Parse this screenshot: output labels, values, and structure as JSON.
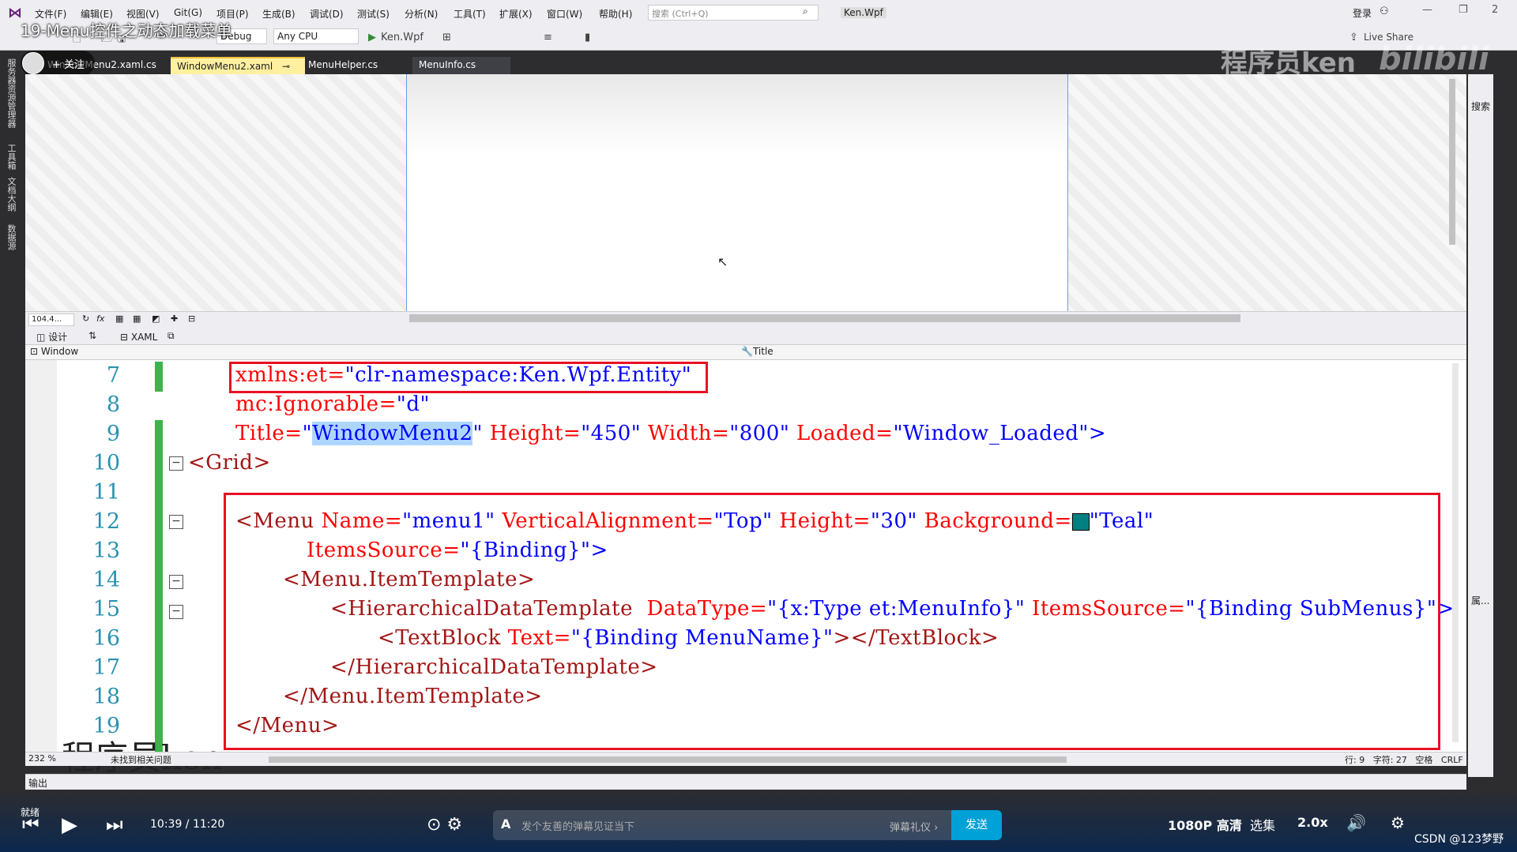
{
  "app": {
    "menu": [
      "文件(F)",
      "编辑(E)",
      "视图(V)",
      "Git(G)",
      "项目(P)",
      "生成(B)",
      "调试(D)",
      "测试(S)",
      "分析(N)",
      "工具(T)",
      "扩展(X)",
      "窗口(W)",
      "帮助(H)"
    ],
    "search_placeholder": "搜索 (Ctrl+Q)",
    "solution_name": "Ken.Wpf",
    "login_label": "登录",
    "live_share_label": "Live Share",
    "help_badge": "2"
  },
  "toolbar": {
    "config": "Debug",
    "platform": "Any CPU",
    "start_target": "Ken.Wpf"
  },
  "video": {
    "title": "19-Menu控件之动态加载菜单",
    "follow_label": "+ 关注",
    "watermark_top": "程序员ken",
    "bili_logo": "bilibili",
    "watermark_bottom": "程序员ken",
    "time": "10:39 / 11:20",
    "danmaku_placeholder": "发个友善的弹幕见证当下",
    "danmaku_gift": "弹幕礼仪 ›",
    "send_label": "发送",
    "quality": "1080P 高清",
    "episodes": "选集",
    "speed": "2.0x",
    "csdn": "CSDN @123梦野"
  },
  "tabs": [
    {
      "label": "WindowMenu2.xaml.cs",
      "active": false
    },
    {
      "label": "WindowMenu2.xaml",
      "active": true
    },
    {
      "label": "MenuHelper.cs",
      "active": false
    },
    {
      "label": "MenuInfo.cs",
      "active": false
    }
  ],
  "left_side_tabs": [
    "服务器资源管理器",
    "工具箱",
    "文档大纲",
    "数据源"
  ],
  "right_side": {
    "search_label": "搜索",
    "properties_label": "属..."
  },
  "designer": {
    "zoom": "104.4...",
    "design_tab": "设计",
    "xaml_tab": "XAML",
    "nav_left": "Window",
    "nav_right": "Title"
  },
  "editor": {
    "line_numbers": [
      "7",
      "8",
      "9",
      "10",
      "11",
      "12",
      "13",
      "14",
      "15",
      "16",
      "17",
      "18",
      "19"
    ],
    "zoom": "232 %",
    "status_line": "行: 9",
    "status_char": "字符: 27",
    "status_space": "空格",
    "status_crlf": "CRLF",
    "bottom_note": "未找到相关问题"
  },
  "code": {
    "l7": {
      "attr": "xmlns:et=",
      "val": "\"clr-namespace:Ken.Wpf.Entity\""
    },
    "l8": {
      "attr": "mc:Ignorable=",
      "val": "\"d\""
    },
    "l9": {
      "attr1": "Title=",
      "q1": "\"",
      "sel": "WindowMenu2",
      "q2": "\"",
      "attr2": " Height=",
      "val2": "\"450\"",
      "attr3": " Width=",
      "val3": "\"800\"",
      "attr4": " Loaded=",
      "val4": "\"Window_Loaded\"",
      "close": ">"
    },
    "l10": {
      "tag": "<Grid>"
    },
    "l12": {
      "tag": "<Menu",
      "a1": " Name=",
      "v1": "\"menu1\"",
      "a2": " VerticalAlignment=",
      "v2": "\"Top\"",
      "a3": " Height=",
      "v3": "\"30\"",
      "a4": " Background=",
      "v4": "\"Teal\""
    },
    "l13": {
      "a1": "ItemsSource=",
      "v1": "\"{Binding}\"",
      "close": ">"
    },
    "l14": {
      "tag": "<Menu.ItemTemplate>"
    },
    "l15": {
      "tag": "<HierarchicalDataTemplate",
      "a1": "  DataType=",
      "v1": "\"{x:Type et:MenuInfo}\"",
      "a2": " ItemsSource=",
      "v2": "\"{Binding SubMenus}\"",
      "close": ">"
    },
    "l16": {
      "tag": "<TextBlock",
      "a1": " Text=",
      "v1": "\"{Binding MenuName}\"",
      "close": "></TextBlock>"
    },
    "l17": {
      "tag": "</HierarchicalDataTemplate>"
    },
    "l18": {
      "tag": "</Menu.ItemTemplate>"
    },
    "l19": {
      "tag": "</Menu>"
    }
  },
  "output": {
    "label": "输出",
    "ready": "就绪"
  },
  "colors": {
    "teal": "#008080",
    "highlight": "#add6ff",
    "annotation_red": "#e81123"
  }
}
